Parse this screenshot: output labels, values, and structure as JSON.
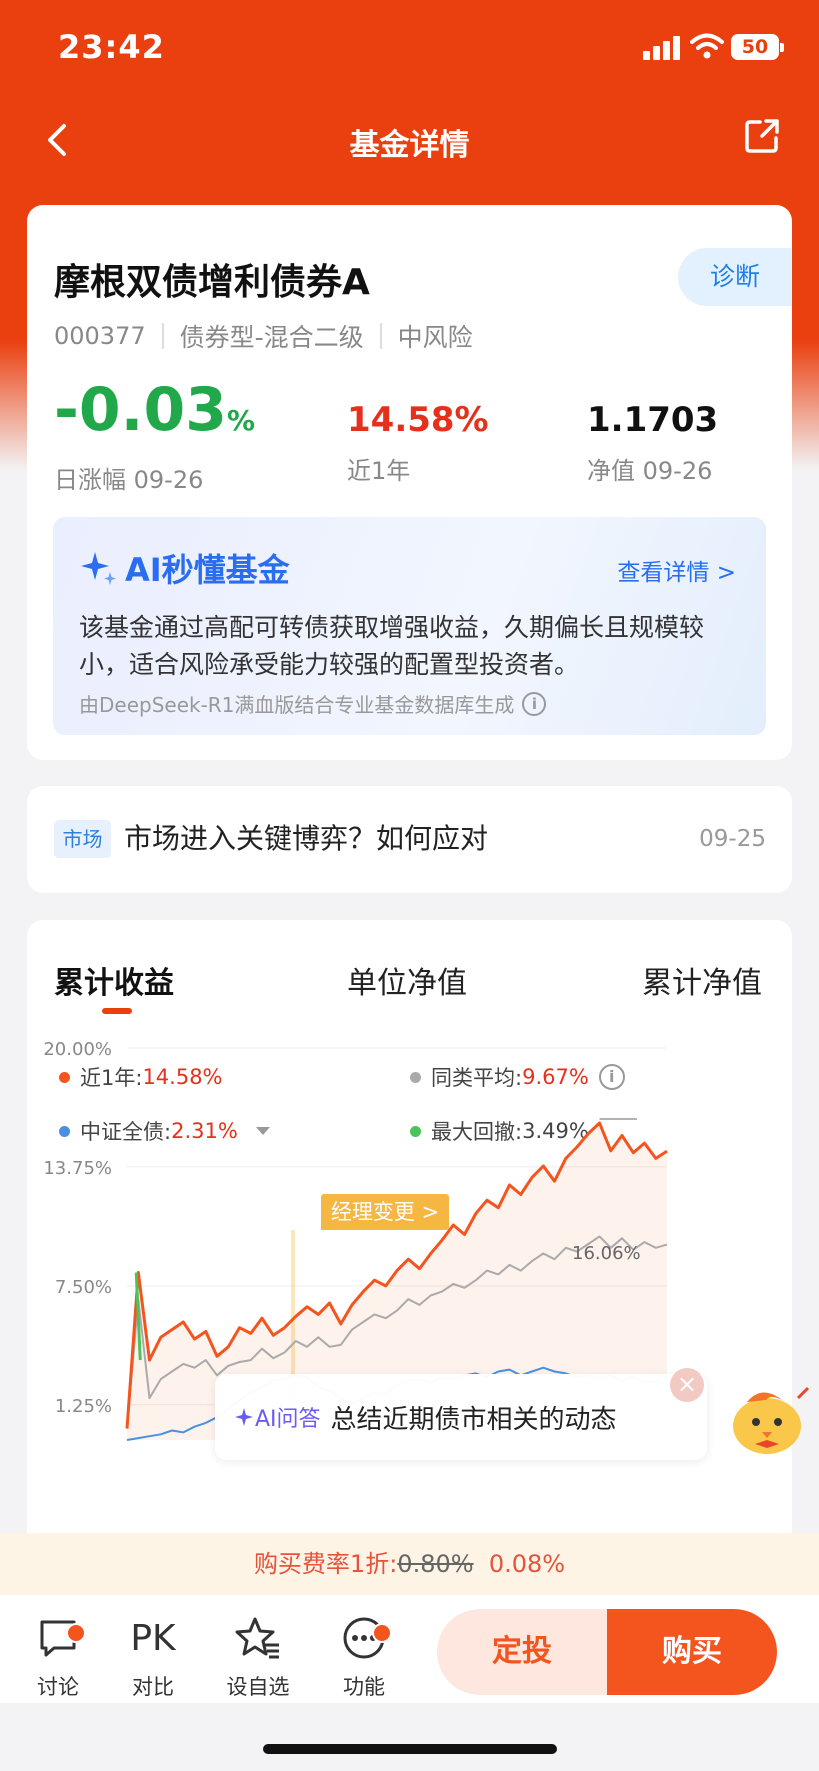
{
  "status": {
    "time": "23:42",
    "battery": "50"
  },
  "nav": {
    "title": "基金详情"
  },
  "fund": {
    "name": "摩根双债增利债券A",
    "diagnose": "诊断",
    "code": "000377",
    "type": "债券型-混合二级",
    "risk": "中风险",
    "daily_change": "-0.03",
    "daily_change_unit": "%",
    "daily_label": "日涨幅 09-26",
    "year_return": "14.58%",
    "year_label": "近1年",
    "nav_value": "1.1703",
    "nav_label": "净值 09-26"
  },
  "ai": {
    "title": "AI秒懂基金",
    "more": "查看详情 >",
    "text": "该基金通过高配可转债获取增强收益，久期偏长且规模较小，适合风险承受能力较强的配置型投资者。",
    "source": "由DeepSeek-R1满血版结合专业基金数据库生成"
  },
  "news": {
    "tag": "市场",
    "title": "市场进入关键博弈？如何应对",
    "date": "09-25"
  },
  "tabs": [
    "累计收益",
    "单位净值",
    "累计净值"
  ],
  "legend": {
    "fund_label": "近1年:",
    "fund_value": "14.58%",
    "peer_label": "同类平均:",
    "peer_value": "9.67%",
    "index_label": "中证全债:",
    "index_value": "2.31%",
    "drawdown_label": "最大回撤:",
    "drawdown_value": "3.49%"
  },
  "colors": {
    "fund": "#f4541d",
    "peer": "#aaaaaa",
    "index": "#4a90e2",
    "drawdown": "#4cc25a",
    "accent": "#ea3f0e"
  },
  "chart_data": {
    "type": "line",
    "ylim": [
      -0.6,
      20
    ],
    "yticks": [
      "20.00%",
      "13.75%",
      "7.50%",
      "1.25%"
    ],
    "annotation_manager": "经理变更 >",
    "peak_label": "16.06%",
    "series": [
      {
        "name": "近1年",
        "values": [
          0.0,
          8.2,
          3.6,
          4.8,
          5.2,
          5.6,
          4.7,
          5.1,
          3.8,
          4.3,
          5.3,
          5.0,
          5.8,
          4.9,
          5.3,
          5.9,
          6.4,
          6.0,
          6.6,
          5.5,
          6.5,
          7.2,
          7.8,
          7.5,
          8.3,
          8.9,
          8.4,
          9.2,
          9.9,
          10.7,
          10.2,
          11.3,
          12.0,
          11.6,
          12.8,
          12.3,
          13.2,
          13.8,
          13.0,
          14.2,
          14.8,
          15.5,
          16.06,
          14.6,
          15.4,
          14.5,
          15.0,
          14.2,
          14.58
        ]
      },
      {
        "name": "同类平均",
        "values": [
          0.0,
          6.8,
          1.6,
          2.6,
          3.0,
          3.4,
          3.2,
          3.6,
          2.8,
          3.3,
          3.5,
          3.6,
          4.2,
          3.7,
          4.0,
          4.6,
          4.3,
          4.8,
          4.3,
          4.4,
          5.2,
          5.6,
          6.0,
          5.8,
          6.2,
          6.8,
          6.5,
          7.0,
          7.2,
          7.6,
          7.4,
          7.8,
          8.3,
          8.1,
          8.6,
          8.3,
          8.8,
          9.2,
          8.9,
          9.5,
          9.3,
          9.7,
          10.1,
          9.5,
          10.0,
          9.4,
          9.8,
          9.5,
          9.67
        ]
      },
      {
        "name": "中证全债",
        "values": [
          -0.6,
          -0.5,
          -0.4,
          -0.3,
          -0.1,
          -0.2,
          0.1,
          0.3,
          0.6,
          1.0,
          1.5,
          1.9,
          2.2,
          2.5,
          2.6,
          2.8,
          2.7,
          2.2,
          2.0,
          1.6,
          1.3,
          1.6,
          1.9,
          1.8,
          2.3,
          2.5,
          2.6,
          2.4,
          2.7,
          2.6,
          2.8,
          2.9,
          2.7,
          3.0,
          3.1,
          2.8,
          3.0,
          3.2,
          3.0,
          2.9,
          2.7,
          2.8,
          2.6,
          2.8,
          2.5,
          2.7,
          2.4,
          2.5,
          2.31
        ]
      }
    ]
  },
  "fee": {
    "label": "购买费率1折:",
    "old": "0.80%",
    "new": "0.08%"
  },
  "ai_ask": {
    "label": "AI问答",
    "question": "总结近期债市相关的动态"
  },
  "toolbar": {
    "discuss": "讨论",
    "compare": "对比",
    "pk_icon": "PK",
    "watch": "设自选",
    "func": "功能",
    "fixed": "定投",
    "buy": "购买"
  }
}
